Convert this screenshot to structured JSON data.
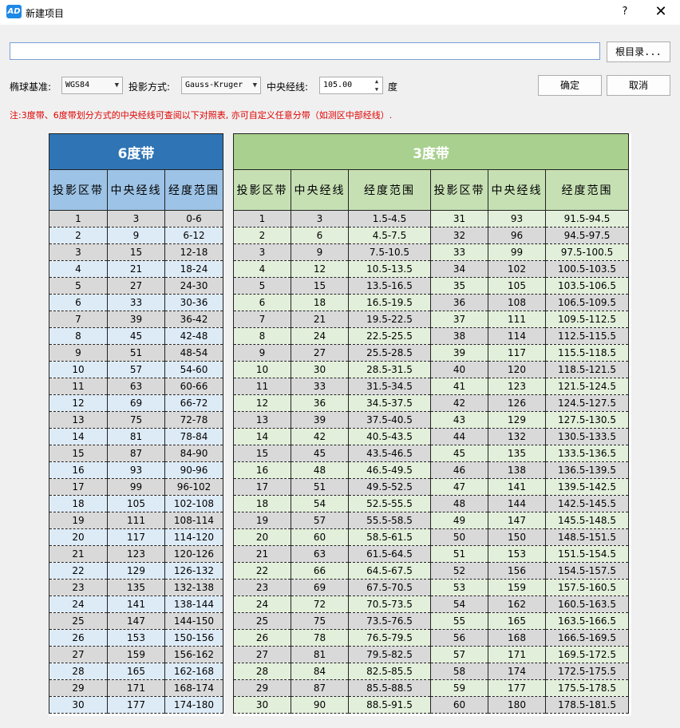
{
  "window": {
    "title": "新建项目",
    "icon_text": "AD",
    "help_label": "?",
    "close_label": "✕"
  },
  "path": {
    "value": "",
    "browse_label": "根目录..."
  },
  "settings": {
    "ellipsoid_label": "椭球基准:",
    "ellipsoid_value": "WGS84",
    "projection_label": "投影方式:",
    "projection_value": "Gauss-Kruger",
    "meridian_label": "中央经线:",
    "meridian_value": "105.00",
    "unit": "度"
  },
  "buttons": {
    "ok": "确定",
    "cancel": "取消"
  },
  "note": "注:3度带、6度带划分方式的中央经线可查阅以下对照表,  亦可自定义任意分带（如测区中部经线）.",
  "table6": {
    "title": "6度带",
    "headers": [
      "投影区带",
      "中央经线",
      "经度范围"
    ],
    "rows": [
      [
        "1",
        "3",
        "0-6"
      ],
      [
        "2",
        "9",
        "6-12"
      ],
      [
        "3",
        "15",
        "12-18"
      ],
      [
        "4",
        "21",
        "18-24"
      ],
      [
        "5",
        "27",
        "24-30"
      ],
      [
        "6",
        "33",
        "30-36"
      ],
      [
        "7",
        "39",
        "36-42"
      ],
      [
        "8",
        "45",
        "42-48"
      ],
      [
        "9",
        "51",
        "48-54"
      ],
      [
        "10",
        "57",
        "54-60"
      ],
      [
        "11",
        "63",
        "60-66"
      ],
      [
        "12",
        "69",
        "66-72"
      ],
      [
        "13",
        "75",
        "72-78"
      ],
      [
        "14",
        "81",
        "78-84"
      ],
      [
        "15",
        "87",
        "84-90"
      ],
      [
        "16",
        "93",
        "90-96"
      ],
      [
        "17",
        "99",
        "96-102"
      ],
      [
        "18",
        "105",
        "102-108"
      ],
      [
        "19",
        "111",
        "108-114"
      ],
      [
        "20",
        "117",
        "114-120"
      ],
      [
        "21",
        "123",
        "120-126"
      ],
      [
        "22",
        "129",
        "126-132"
      ],
      [
        "23",
        "135",
        "132-138"
      ],
      [
        "24",
        "141",
        "138-144"
      ],
      [
        "25",
        "147",
        "144-150"
      ],
      [
        "26",
        "153",
        "150-156"
      ],
      [
        "27",
        "159",
        "156-162"
      ],
      [
        "28",
        "165",
        "162-168"
      ],
      [
        "29",
        "171",
        "168-174"
      ],
      [
        "30",
        "177",
        "174-180"
      ]
    ]
  },
  "table3": {
    "title": "3度带",
    "headers": [
      "投影区带",
      "中央经线",
      "经度范围",
      "投影区带",
      "中央经线",
      "经度范围"
    ],
    "rows": [
      [
        "1",
        "3",
        "1.5-4.5",
        "31",
        "93",
        "91.5-94.5"
      ],
      [
        "2",
        "6",
        "4.5-7.5",
        "32",
        "96",
        "94.5-97.5"
      ],
      [
        "3",
        "9",
        "7.5-10.5",
        "33",
        "99",
        "97.5-100.5"
      ],
      [
        "4",
        "12",
        "10.5-13.5",
        "34",
        "102",
        "100.5-103.5"
      ],
      [
        "5",
        "15",
        "13.5-16.5",
        "35",
        "105",
        "103.5-106.5"
      ],
      [
        "6",
        "18",
        "16.5-19.5",
        "36",
        "108",
        "106.5-109.5"
      ],
      [
        "7",
        "21",
        "19.5-22.5",
        "37",
        "111",
        "109.5-112.5"
      ],
      [
        "8",
        "24",
        "22.5-25.5",
        "38",
        "114",
        "112.5-115.5"
      ],
      [
        "9",
        "27",
        "25.5-28.5",
        "39",
        "117",
        "115.5-118.5"
      ],
      [
        "10",
        "30",
        "28.5-31.5",
        "40",
        "120",
        "118.5-121.5"
      ],
      [
        "11",
        "33",
        "31.5-34.5",
        "41",
        "123",
        "121.5-124.5"
      ],
      [
        "12",
        "36",
        "34.5-37.5",
        "42",
        "126",
        "124.5-127.5"
      ],
      [
        "13",
        "39",
        "37.5-40.5",
        "43",
        "129",
        "127.5-130.5"
      ],
      [
        "14",
        "42",
        "40.5-43.5",
        "44",
        "132",
        "130.5-133.5"
      ],
      [
        "15",
        "45",
        "43.5-46.5",
        "45",
        "135",
        "133.5-136.5"
      ],
      [
        "16",
        "48",
        "46.5-49.5",
        "46",
        "138",
        "136.5-139.5"
      ],
      [
        "17",
        "51",
        "49.5-52.5",
        "47",
        "141",
        "139.5-142.5"
      ],
      [
        "18",
        "54",
        "52.5-55.5",
        "48",
        "144",
        "142.5-145.5"
      ],
      [
        "19",
        "57",
        "55.5-58.5",
        "49",
        "147",
        "145.5-148.5"
      ],
      [
        "20",
        "60",
        "58.5-61.5",
        "50",
        "150",
        "148.5-151.5"
      ],
      [
        "21",
        "63",
        "61.5-64.5",
        "51",
        "153",
        "151.5-154.5"
      ],
      [
        "22",
        "66",
        "64.5-67.5",
        "52",
        "156",
        "154.5-157.5"
      ],
      [
        "23",
        "69",
        "67.5-70.5",
        "53",
        "159",
        "157.5-160.5"
      ],
      [
        "24",
        "72",
        "70.5-73.5",
        "54",
        "162",
        "160.5-163.5"
      ],
      [
        "25",
        "75",
        "73.5-76.5",
        "55",
        "165",
        "163.5-166.5"
      ],
      [
        "26",
        "78",
        "76.5-79.5",
        "56",
        "168",
        "166.5-169.5"
      ],
      [
        "27",
        "81",
        "79.5-82.5",
        "57",
        "171",
        "169.5-172.5"
      ],
      [
        "28",
        "84",
        "82.5-85.5",
        "58",
        "174",
        "172.5-175.5"
      ],
      [
        "29",
        "87",
        "85.5-88.5",
        "59",
        "177",
        "175.5-178.5"
      ],
      [
        "30",
        "90",
        "88.5-91.5",
        "60",
        "180",
        "178.5-181.5"
      ]
    ]
  },
  "colors": {
    "header6": "#2f75b5",
    "header3": "#a9d08e",
    "note": "#e00000"
  }
}
